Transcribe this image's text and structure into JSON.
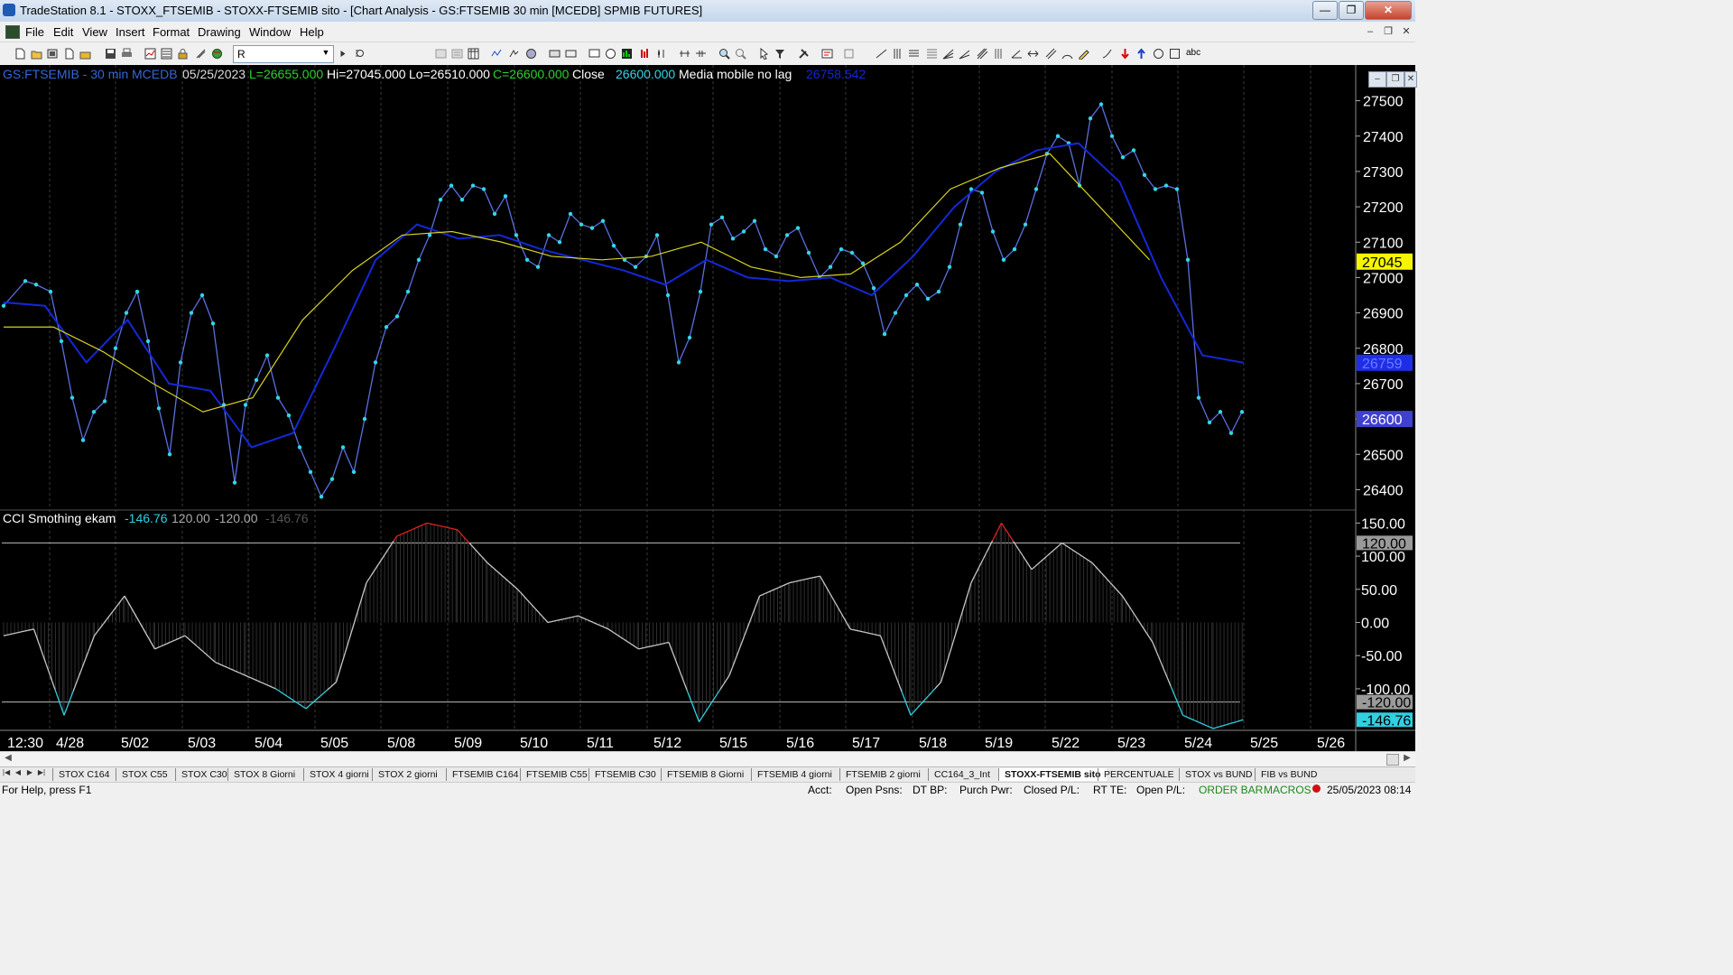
{
  "window": {
    "title": "TradeStation 8.1 - STOXX_FTSEMIB - STOXX-FTSEMIB sito - [Chart Analysis - GS:FTSEMIB  30 min  [MCEDB] SPMIB FUTURES]",
    "minimize": "—",
    "maximize": "❐",
    "close": "✕"
  },
  "menu": {
    "items": [
      "File",
      "Edit",
      "View",
      "Insert",
      "Format",
      "Drawing",
      "Window",
      "Help"
    ],
    "mdi_controls": [
      "–",
      "❐",
      "✕"
    ]
  },
  "toolbar": {
    "symbol_value": "R",
    "text_tool": "abc"
  },
  "chart_header": {
    "symbol": "GS:FTSEMIB - 30 min",
    "exchange": "MCEDB",
    "date": "05/25/2023",
    "last": "L=26655.000",
    "high": "Hi=27045.000",
    "low": "Lo=26510.000",
    "close_val": "C=26600.000",
    "close_label": "Close",
    "close_value": "26600.000",
    "study_name": "Media mobile no lag",
    "study_value": "26758.542"
  },
  "indicator_header": {
    "name": "CCI Smothing ekam",
    "value": "-146.76",
    "upper": "120.00",
    "lower": "-120.00",
    "last": "-146.76"
  },
  "price_axis": {
    "ticks": [
      "27500",
      "27400",
      "27300",
      "27200",
      "27100",
      "27000",
      "26900",
      "26800",
      "26700",
      "26600",
      "26500",
      "26400"
    ],
    "marker_high": "27045",
    "marker_ma": "26759",
    "marker_last": "26600"
  },
  "cci_axis": {
    "ticks": [
      "150.00",
      "100.00",
      "50.00",
      "0.00",
      "-50.00",
      "-100.00"
    ],
    "marker_upper": "120.00",
    "marker_lower": "-120.00",
    "marker_value": "-146.76"
  },
  "time_axis": {
    "labels": [
      "12:30",
      "4/28",
      "5/02",
      "5/03",
      "5/04",
      "5/05",
      "5/08",
      "5/09",
      "5/10",
      "5/11",
      "5/12",
      "5/15",
      "5/16",
      "5/17",
      "5/18",
      "5/19",
      "5/22",
      "5/23",
      "5/24",
      "5/25",
      "5/26"
    ]
  },
  "tabs": {
    "items": [
      "STOX C164",
      "STOX C55",
      "STOX  C30",
      "STOX  8 Giorni",
      "STOX 4 giorni",
      "STOX  2 giorni",
      "FTSEMIB C164",
      "FTSEMIB C55",
      "FTSEMIB C30",
      "FTSEMIB  8 Giorni",
      "FTSEMIB  4 giorni",
      "FTSEMIB  2 giorni",
      "CC164_3_Int",
      "STOXX-FTSEMIB sito",
      "PERCENTUALE",
      "STOX vs BUND",
      "FIB vs BUND"
    ],
    "active_index": 13
  },
  "status": {
    "help": "For Help, press F1",
    "acct": "Acct:",
    "open_psns": "Open Psns:",
    "dt_bp": "DT BP:",
    "purch_pwr": "Purch Pwr:",
    "closed_pl": "Closed P/L:",
    "rt_te": "RT TE:",
    "open_pl": "Open P/L:",
    "order_bar": "ORDER BAR",
    "macros": "MACROS",
    "datetime": "25/05/2023 08:14"
  },
  "colors": {
    "price": "#33d6e6",
    "ma_blue": "#1428d8",
    "ma_yellow": "#d6d21e",
    "cci_line": "#c8c8c8",
    "cci_low": "#2fd0e0",
    "cci_high": "#e02020"
  },
  "chart_data": [
    {
      "type": "line",
      "title": "GS:FTSEMIB - 30 min",
      "x": [
        "4/28",
        "5/02",
        "5/03",
        "5/04",
        "5/05",
        "5/08",
        "5/09",
        "5/10",
        "5/11",
        "5/12",
        "5/15",
        "5/16",
        "5/17",
        "5/18",
        "5/19",
        "5/22",
        "5/23",
        "5/24"
      ],
      "ylim": [
        26350,
        27550
      ],
      "series": [
        {
          "name": "Close",
          "values": [
            [
              0,
              26920
            ],
            [
              6,
              26990
            ],
            [
              9,
              26980
            ],
            [
              13,
              26960
            ],
            [
              16,
              26820
            ],
            [
              19,
              26660
            ],
            [
              22,
              26540
            ],
            [
              25,
              26620
            ],
            [
              28,
              26650
            ],
            [
              31,
              26800
            ],
            [
              34,
              26900
            ],
            [
              37,
              26960
            ],
            [
              40,
              26820
            ],
            [
              43,
              26630
            ],
            [
              46,
              26500
            ],
            [
              49,
              26760
            ],
            [
              52,
              26900
            ],
            [
              55,
              26950
            ],
            [
              58,
              26870
            ],
            [
              61,
              26640
            ],
            [
              64,
              26420
            ],
            [
              67,
              26640
            ],
            [
              70,
              26710
            ],
            [
              73,
              26780
            ],
            [
              76,
              26660
            ],
            [
              79,
              26610
            ],
            [
              82,
              26520
            ],
            [
              85,
              26450
            ],
            [
              88,
              26380
            ],
            [
              91,
              26430
            ],
            [
              94,
              26520
            ],
            [
              97,
              26450
            ],
            [
              100,
              26600
            ],
            [
              103,
              26760
            ],
            [
              106,
              26860
            ],
            [
              109,
              26890
            ],
            [
              112,
              26960
            ],
            [
              115,
              27050
            ],
            [
              118,
              27120
            ],
            [
              121,
              27220
            ],
            [
              124,
              27260
            ],
            [
              127,
              27220
            ],
            [
              130,
              27260
            ],
            [
              133,
              27250
            ],
            [
              136,
              27180
            ],
            [
              139,
              27230
            ],
            [
              142,
              27120
            ],
            [
              145,
              27050
            ],
            [
              148,
              27030
            ],
            [
              151,
              27120
            ],
            [
              154,
              27100
            ],
            [
              157,
              27180
            ],
            [
              160,
              27150
            ],
            [
              163,
              27140
            ],
            [
              166,
              27160
            ],
            [
              169,
              27090
            ],
            [
              172,
              27050
            ],
            [
              175,
              27030
            ],
            [
              178,
              27060
            ],
            [
              181,
              27120
            ],
            [
              184,
              26950
            ],
            [
              187,
              26760
            ],
            [
              190,
              26830
            ],
            [
              193,
              26960
            ],
            [
              196,
              27150
            ],
            [
              199,
              27170
            ],
            [
              202,
              27110
            ],
            [
              205,
              27130
            ],
            [
              208,
              27160
            ],
            [
              211,
              27080
            ],
            [
              214,
              27060
            ],
            [
              217,
              27120
            ],
            [
              220,
              27140
            ],
            [
              223,
              27070
            ],
            [
              226,
              27000
            ],
            [
              229,
              27030
            ],
            [
              232,
              27080
            ],
            [
              235,
              27070
            ],
            [
              238,
              27040
            ],
            [
              241,
              26970
            ],
            [
              244,
              26840
            ],
            [
              247,
              26900
            ],
            [
              250,
              26950
            ],
            [
              253,
              26980
            ],
            [
              256,
              26940
            ],
            [
              259,
              26960
            ],
            [
              262,
              27030
            ],
            [
              265,
              27150
            ],
            [
              268,
              27250
            ],
            [
              271,
              27240
            ],
            [
              274,
              27130
            ],
            [
              277,
              27050
            ],
            [
              280,
              27080
            ],
            [
              283,
              27150
            ],
            [
              286,
              27250
            ],
            [
              289,
              27350
            ],
            [
              292,
              27400
            ],
            [
              295,
              27380
            ],
            [
              298,
              27260
            ],
            [
              301,
              27450
            ],
            [
              304,
              27490
            ],
            [
              307,
              27400
            ],
            [
              310,
              27340
            ],
            [
              313,
              27360
            ],
            [
              316,
              27290
            ],
            [
              319,
              27250
            ],
            [
              322,
              27260
            ],
            [
              325,
              27250
            ],
            [
              328,
              27050
            ],
            [
              331,
              26660
            ],
            [
              334,
              26590
            ],
            [
              337,
              26620
            ],
            [
              340,
              26560
            ],
            [
              343,
              26620
            ]
          ]
        },
        {
          "name": "Media mobile no lag",
          "values": [
            [
              0,
              26930
            ],
            [
              10,
              26920
            ],
            [
              20,
              26760
            ],
            [
              30,
              26880
            ],
            [
              40,
              26700
            ],
            [
              50,
              26680
            ],
            [
              60,
              26520
            ],
            [
              70,
              26560
            ],
            [
              80,
              26800
            ],
            [
              90,
              27050
            ],
            [
              100,
              27150
            ],
            [
              110,
              27110
            ],
            [
              120,
              27120
            ],
            [
              130,
              27080
            ],
            [
              140,
              27050
            ],
            [
              150,
              27020
            ],
            [
              160,
              26980
            ],
            [
              170,
              27050
            ],
            [
              180,
              27000
            ],
            [
              190,
              26990
            ],
            [
              200,
              27000
            ],
            [
              210,
              26950
            ],
            [
              220,
              27060
            ],
            [
              230,
              27200
            ],
            [
              240,
              27300
            ],
            [
              250,
              27360
            ],
            [
              260,
              27380
            ],
            [
              270,
              27270
            ],
            [
              280,
              27000
            ],
            [
              290,
              26780
            ],
            [
              300,
              26759
            ]
          ]
        },
        {
          "name": "",
          "values": [
            [
              0,
              26860
            ],
            [
              10,
              26860
            ],
            [
              20,
              26790
            ],
            [
              30,
              26700
            ],
            [
              40,
              26620
            ],
            [
              50,
              26660
            ],
            [
              60,
              26880
            ],
            [
              70,
              27020
            ],
            [
              80,
              27120
            ],
            [
              90,
              27130
            ],
            [
              100,
              27100
            ],
            [
              110,
              27060
            ],
            [
              120,
              27050
            ],
            [
              130,
              27060
            ],
            [
              140,
              27100
            ],
            [
              150,
              27030
            ],
            [
              160,
              27000
            ],
            [
              170,
              27010
            ],
            [
              180,
              27100
            ],
            [
              190,
              27250
            ],
            [
              200,
              27310
            ],
            [
              210,
              27350
            ],
            [
              220,
              27200
            ],
            [
              230,
              27050
            ]
          ]
        }
      ]
    },
    {
      "type": "area",
      "title": "CCI Smothing ekam",
      "ylim": [
        -160,
        160
      ],
      "series": [
        {
          "name": "CCI Smothing ekam",
          "values": [
            [
              0,
              -20
            ],
            [
              10,
              -10
            ],
            [
              20,
              -140
            ],
            [
              30,
              -20
            ],
            [
              40,
              40
            ],
            [
              50,
              -40
            ],
            [
              60,
              -20
            ],
            [
              70,
              -60
            ],
            [
              80,
              -80
            ],
            [
              90,
              -100
            ],
            [
              100,
              -130
            ],
            [
              110,
              -90
            ],
            [
              120,
              60
            ],
            [
              130,
              130
            ],
            [
              140,
              150
            ],
            [
              150,
              140
            ],
            [
              160,
              90
            ],
            [
              170,
              50
            ],
            [
              180,
              0
            ],
            [
              190,
              10
            ],
            [
              200,
              -10
            ],
            [
              210,
              -40
            ],
            [
              220,
              -30
            ],
            [
              230,
              -150
            ],
            [
              240,
              -80
            ],
            [
              250,
              40
            ],
            [
              260,
              60
            ],
            [
              270,
              70
            ],
            [
              280,
              -10
            ],
            [
              290,
              -20
            ],
            [
              300,
              -140
            ],
            [
              310,
              -90
            ],
            [
              320,
              60
            ],
            [
              330,
              150
            ],
            [
              340,
              80
            ],
            [
              350,
              120
            ],
            [
              360,
              90
            ],
            [
              370,
              40
            ],
            [
              380,
              -30
            ],
            [
              390,
              -140
            ],
            [
              400,
              -160
            ],
            [
              410,
              -146.76
            ]
          ]
        }
      ]
    }
  ]
}
